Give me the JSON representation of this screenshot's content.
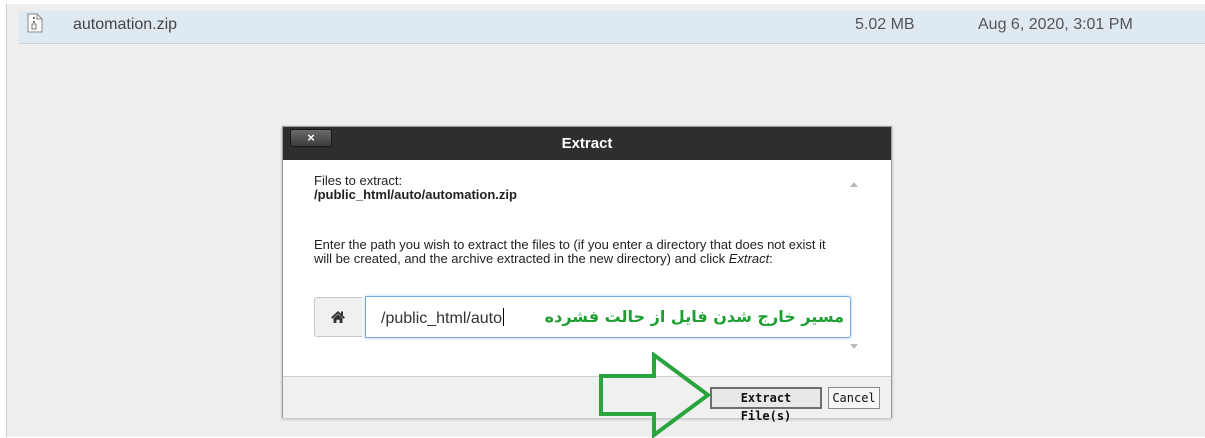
{
  "file_row": {
    "icon": "zip-file-icon",
    "name": "automation.zip",
    "size": "5.02 MB",
    "modified": "Aug 6, 2020, 3:01 PM"
  },
  "dialog": {
    "title": "Extract",
    "close_label": "×",
    "files_label": "Files to extract:",
    "files_path": "/public_html/auto/automation.zip",
    "instructions_main": "Enter the path you wish to extract the files to (if you enter a directory that does not exist it will be created, and the archive extracted in the new directory) and click ",
    "instructions_emphasis": "Extract",
    "instructions_end": ":",
    "home_icon": "home-icon",
    "path_value": "/public_html/auto",
    "annotation": "مسیر خارج شدن فایل از حالت فشرده",
    "extract_button": "Extract File(s)",
    "cancel_button": "Cancel"
  },
  "annotation_arrow": {
    "color": "#2aa43d",
    "direction": "right"
  },
  "colors": {
    "header": "#2e2e2e",
    "row_highlight": "#dfe9f2",
    "input_focus": "#7aa9e8"
  }
}
